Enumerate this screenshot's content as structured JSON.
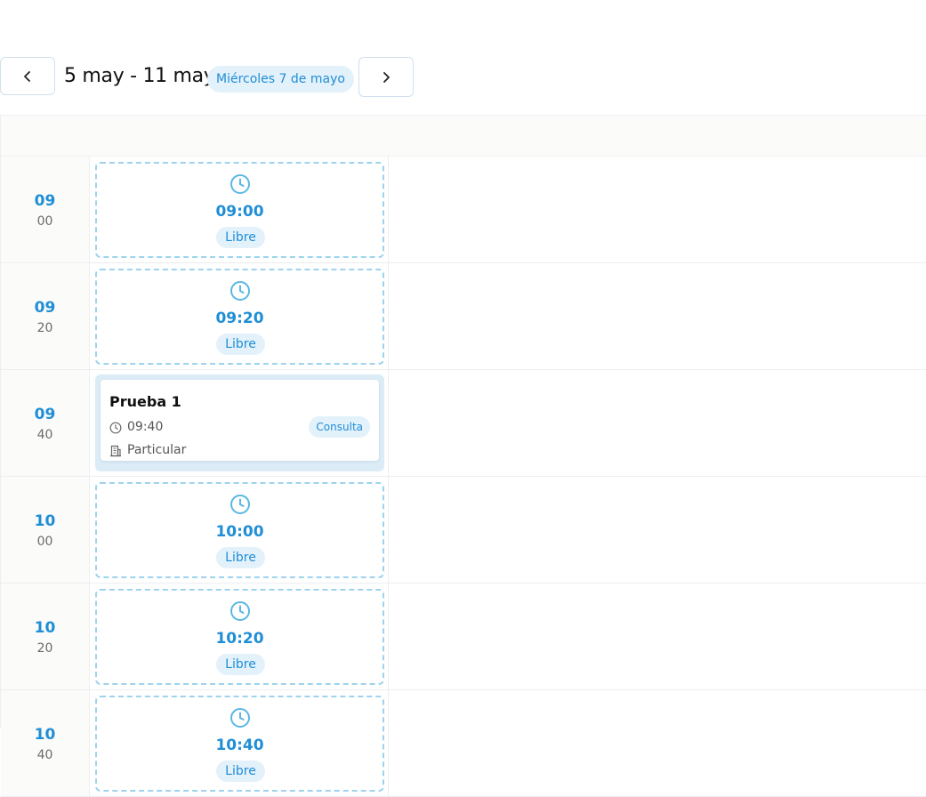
{
  "toolbar": {
    "prev_icon": "chevron-left-icon",
    "next_icon": "chevron-right-icon",
    "range_title": "5 may - 11 may",
    "today_label": "Miércoles 7 de mayo"
  },
  "colors": {
    "accent": "#1f8ed6",
    "accent_soft": "#e3f1fb",
    "dashed_border": "#9ed3ee",
    "appointment_bg": "#dcecf7"
  },
  "rows": [
    {
      "hour": "09",
      "minute": "00",
      "kind": "free",
      "slot_time": "09:00",
      "slot_label": "Libre"
    },
    {
      "hour": "09",
      "minute": "20",
      "kind": "free",
      "slot_time": "09:20",
      "slot_label": "Libre"
    },
    {
      "hour": "09",
      "minute": "40",
      "kind": "appointment",
      "appointment": {
        "title": "Prueba 1",
        "time": "09:40",
        "type": "Consulta",
        "insurance": "Particular"
      }
    },
    {
      "hour": "10",
      "minute": "00",
      "kind": "free",
      "slot_time": "10:00",
      "slot_label": "Libre"
    },
    {
      "hour": "10",
      "minute": "20",
      "kind": "free",
      "slot_time": "10:20",
      "slot_label": "Libre"
    },
    {
      "hour": "10",
      "minute": "40",
      "kind": "free",
      "slot_time": "10:40",
      "slot_label": "Libre"
    }
  ]
}
